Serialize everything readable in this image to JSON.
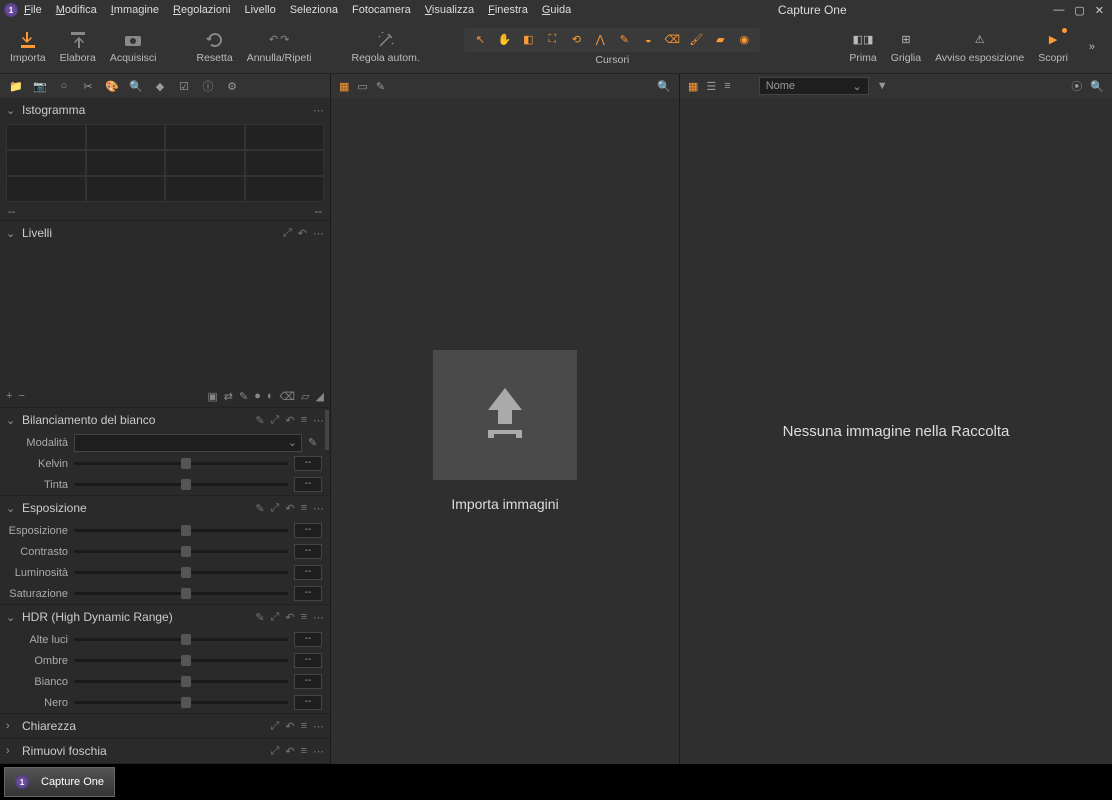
{
  "app_title": "Capture One",
  "menu": [
    "File",
    "Modifica",
    "Immagine",
    "Regolazioni",
    "Livello",
    "Seleziona",
    "Fotocamera",
    "Visualizza",
    "Finestra",
    "Guida"
  ],
  "toolbar_left": [
    {
      "label": "Importa",
      "icon": "download"
    },
    {
      "label": "Elabora",
      "icon": "upload"
    },
    {
      "label": "Acquisisci",
      "icon": "camera"
    }
  ],
  "toolbar_mid": [
    {
      "label": "Resetta",
      "icon": "reset"
    },
    {
      "label": "Annulla/Ripeti",
      "icon": "undoredo"
    }
  ],
  "toolbar_adjust": {
    "label": "Regola autom.",
    "icon": "wand"
  },
  "cursor_label": "Cursori",
  "toolbar_right": [
    {
      "label": "Prima",
      "icon": "compare"
    },
    {
      "label": "Griglia",
      "icon": "grid"
    },
    {
      "label": "Avviso esposizione",
      "icon": "warn"
    },
    {
      "label": "Scopri",
      "icon": "play"
    }
  ],
  "sections": {
    "histogram": {
      "title": "Istogramma",
      "footL": "--",
      "footR": "--"
    },
    "levels": {
      "title": "Livelli"
    },
    "wb": {
      "title": "Bilanciamento del bianco",
      "mode_label": "Modalità",
      "kelvin": "Kelvin",
      "tint": "Tinta",
      "dash": "--"
    },
    "exposure": {
      "title": "Esposizione",
      "rows": [
        "Esposizione",
        "Contrasto",
        "Luminosità",
        "Saturazione"
      ],
      "dash": "--"
    },
    "hdr": {
      "title": "HDR (High Dynamic Range)",
      "rows": [
        "Alte luci",
        "Ombre",
        "Bianco",
        "Nero"
      ],
      "dash": "--"
    },
    "clarity": {
      "title": "Chiarezza"
    },
    "dehaze": {
      "title": "Rimuovi foschia"
    }
  },
  "center": {
    "import_label": "Importa immagini"
  },
  "right": {
    "sort_label": "Nome",
    "empty": "Nessuna immagine nella Raccolta"
  },
  "taskbar": {
    "app": "Capture One"
  }
}
